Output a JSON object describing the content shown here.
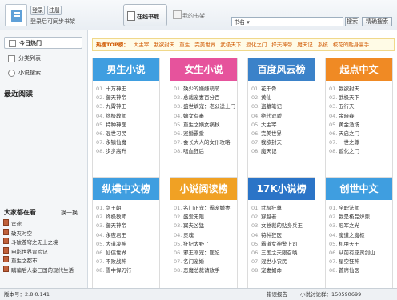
{
  "header": {
    "login": "登录",
    "register": "注册",
    "login_tip": "登录后可同步书架",
    "tab_online": "在线书城",
    "tab_shelf": "我的书架",
    "search_type": "书名 ▾",
    "search_value": "",
    "search_button": "搜索",
    "exact_button": "精确搜索"
  },
  "sidebar": {
    "items": [
      {
        "label": "今日热门",
        "icon": "fire-icon"
      },
      {
        "label": "分类列表",
        "icon": "list-icon"
      },
      {
        "label": "小说搜索",
        "icon": "search-icon"
      }
    ],
    "recent_title": "最近阅读",
    "everyone_title": "大家都在看",
    "refresh": "换一换",
    "everyone_items": [
      "官途",
      "破灭时空",
      "斗破苍穹之无上之境",
      "电影世界冒险记",
      "重生之都市",
      "瞒骗后人秦三国的现代生活"
    ]
  },
  "hotbar": {
    "label": "热搜TOP榜：",
    "keywords": [
      "大主宰",
      "我欲封天",
      "重生",
      "完美世界",
      "武极天下",
      "遮化之门",
      "择天神帝",
      "魔天记",
      "系统",
      "校花的贴身高手"
    ]
  },
  "charts": [
    {
      "title": "男生小说",
      "color": "#3f9ee0",
      "items": [
        "十万神王",
        "御天神帝",
        "九霄神王",
        "终极教师",
        "特种神医",
        "混世刁民",
        "永镇仙魔",
        "步步高升"
      ]
    },
    {
      "title": "女生小说",
      "color": "#e6539c",
      "items": [
        "殃少的嫌嫌萌萌",
        "总裁宠妻百分百",
        "盛世嫡宠：老公送上门",
        "嫡女有毒",
        "重生之嫡女祸秋",
        "宠婚霸爱",
        "会长大人的女仆攻略",
        "嗜血狂后"
      ]
    },
    {
      "title": "百度风云榜",
      "color": "#3b82c9",
      "items": [
        "花千骨",
        "黄仙",
        "盗墓笔记",
        "绝代双骄",
        "大主宰",
        "完美世界",
        "我欲封天",
        "魔天记"
      ]
    },
    {
      "title": "起点中文",
      "color": "#f08a24",
      "items": [
        "我欲封天",
        "武极天下",
        "五行天",
        "金晓春",
        "黄金渔场",
        "天启之门",
        "一世之尊",
        "遮化之门"
      ]
    },
    {
      "title": "纵横中文榜",
      "color": "#3f9ee0",
      "items": [
        "剑王朝",
        "终极教师",
        "御天神帝",
        "永夜君王",
        "大道凌神",
        "仙侠世界",
        "不败战神",
        "雪中悍刀行"
      ]
    },
    {
      "title": "小说阅读榜",
      "color": "#f0a124",
      "items": [
        "名门正宠：霸宠婚妻",
        "盛爱无限",
        "冥夫凶猛",
        "灵魂",
        "狂妃太野了",
        "邪王溺宠：医妃",
        "名门宠婚",
        "恶魔总裁请放手"
      ]
    },
    {
      "title": "17K小说榜",
      "color": "#2b74c7",
      "items": [
        "武极狂尊",
        "穿越者",
        "女总裁的贴身兵王",
        "特种狂医",
        "霸道女神警上司",
        "三国之天限召唤",
        "混世小农民",
        "宠妻如命"
      ]
    },
    {
      "title": "创世中文",
      "color": "#3f9ee0",
      "items": [
        "全职法师",
        "我是极品炉鼎",
        "冠军之光",
        "魔道之魔枢",
        "机甲天王",
        "从前有座灵剑山",
        "星空狂神",
        "首席仙医"
      ]
    }
  ],
  "status": {
    "version": "版本号：2.8.0.141",
    "report": "错误报告",
    "forum": "小说讨论群：150590699"
  }
}
